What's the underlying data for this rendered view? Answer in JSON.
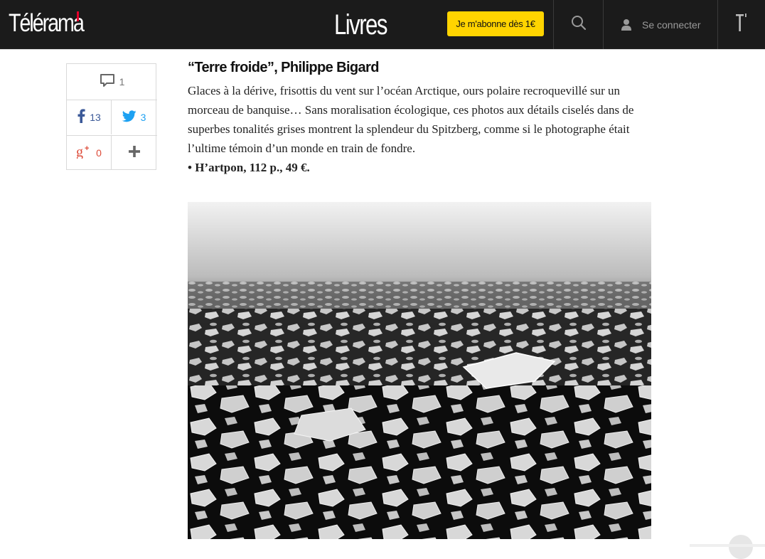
{
  "header": {
    "logo": "Télérama",
    "section": "Livres",
    "subscribe_label": "Je m'abonne dès 1€",
    "login_label": "Se connecter",
    "search_icon": "search-icon",
    "user_icon": "user-icon",
    "telerama_mark_icon": "telerama-t-icon"
  },
  "share": {
    "comments_count": "1",
    "facebook_count": "13",
    "twitter_count": "3",
    "googleplus_count": "0",
    "colors": {
      "facebook": "#3b5998",
      "twitter": "#1da1f2",
      "googleplus": "#dd4b39"
    }
  },
  "article": {
    "title": "“Terre froide”, Philippe Bigard",
    "body": "Glaces à la dérive, frisottis du vent sur l’océan Arctique, ours polaire recroquevillé sur un morceau de banquise… Sans moralisation écologique, ces photos aux détails ciselés dans de superbes tonalités grises montrent la splendeur du Spitzberg, comme si le photographe était l’ultime témoin d’un monde en train de fondre.",
    "reference": "• H’artpon, 112 p., 49 €."
  },
  "colors": {
    "header_bg": "#1b1b1b",
    "accent": "#ffd400",
    "logo_mark": "#e4002b"
  }
}
